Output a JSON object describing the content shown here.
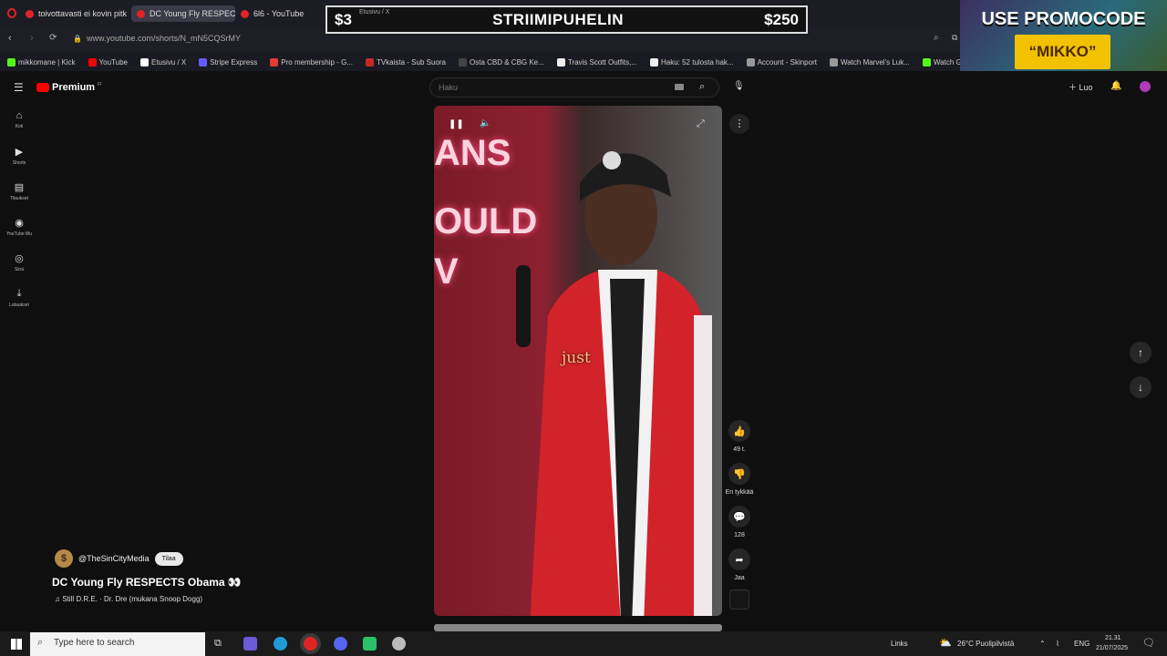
{
  "browser": {
    "tabs": [
      {
        "label": "toivottavasti ei kovin pitk"
      },
      {
        "label": "DC Young Fly RESPEC"
      },
      {
        "label": "6l6 - YouTube"
      }
    ],
    "url": "www.youtube.com/shorts/N_mN5CQSrMY",
    "bookmarks": [
      {
        "label": "mikkomane | Kick",
        "color": "#53fc18"
      },
      {
        "label": "YouTube",
        "color": "#ff0000"
      },
      {
        "label": "Etusivu / X",
        "color": "#ffffff"
      },
      {
        "label": "Stripe Express",
        "color": "#635bff"
      },
      {
        "label": "Pro membership - G...",
        "color": "#e53935"
      },
      {
        "label": "TVkaista - Sub Suora",
        "color": "#c62828"
      },
      {
        "label": "Osta CBD & CBG Ke...",
        "color": "#444444"
      },
      {
        "label": "Travis Scott Outfits,...",
        "color": "#eeeeee"
      },
      {
        "label": "Haku: 52 tulosta hak...",
        "color": "#eeeeee"
      },
      {
        "label": "Account - Skinport",
        "color": "#999999"
      },
      {
        "label": "Watch Marvel's Luk...",
        "color": "#999999"
      },
      {
        "label": "Watch Global & Loc...",
        "color": "#53fc18"
      }
    ]
  },
  "overlay": {
    "left_price": "$3",
    "title": "STRIIMIPUHELIN",
    "right_price": "$250",
    "sub": "Etusivu / X",
    "promo_line1": "USE PROMOCODE",
    "promo_line2": "“MIKKO”"
  },
  "youtube": {
    "logo": "Premium",
    "logo_sup": "FI",
    "search_placeholder": "Haku",
    "create_label": "Luo",
    "sidebar": [
      {
        "label": "Koti",
        "icon": "home-icon"
      },
      {
        "label": "Shorts",
        "icon": "shorts-icon"
      },
      {
        "label": "Tilaukset",
        "icon": "subscriptions-icon"
      },
      {
        "label": "YouTube Mu",
        "icon": "music-icon"
      },
      {
        "label": "Sinä",
        "icon": "you-icon"
      },
      {
        "label": "Lataukset",
        "icon": "download-icon"
      }
    ],
    "video": {
      "neon_text": [
        "ANS",
        "OULD",
        "V"
      ],
      "caption": "just"
    },
    "actions": {
      "likes": "49 t.",
      "dislike": "En tykkää",
      "comments": "128",
      "share": "Jaa"
    },
    "channel": {
      "name": "@TheSinCityMedia",
      "subscribe": "Tilaa",
      "title": "DC Young Fly RESPECTS Obama 👀",
      "song": "Still D.R.E. · Dr. Dre (mukana Snoop Dogg)"
    }
  },
  "taskbar": {
    "search_placeholder": "Type here to search",
    "links": "Links",
    "weather": "26°C  Puolipilvistä",
    "lang": "ENG",
    "time": "21.31",
    "date": "21/07/2025"
  }
}
